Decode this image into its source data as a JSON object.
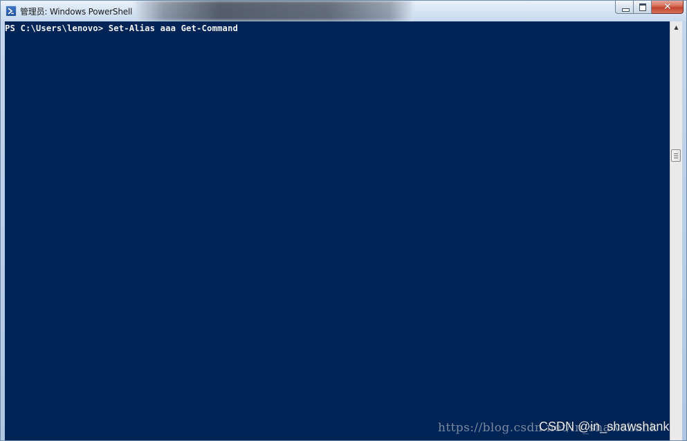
{
  "window": {
    "title": "管理员: Windows PowerShell",
    "icon": "powershell-icon",
    "controls": {
      "minimize": "minimize-icon",
      "maximize": "maximize-icon",
      "close": "close-icon",
      "close_glyph": "✕"
    }
  },
  "console": {
    "background_color": "#012456",
    "text_color": "#f2f2f2",
    "lines": [
      "PS C:\\Users\\lenovo> Set-Alias aaa Get-Command"
    ]
  },
  "scrollbar": {
    "up_arrow": "▲"
  },
  "watermark": {
    "url_text": "https://blog.csdn.net/in_shawshank",
    "brand_text": "CSDN @in_shawshank"
  }
}
